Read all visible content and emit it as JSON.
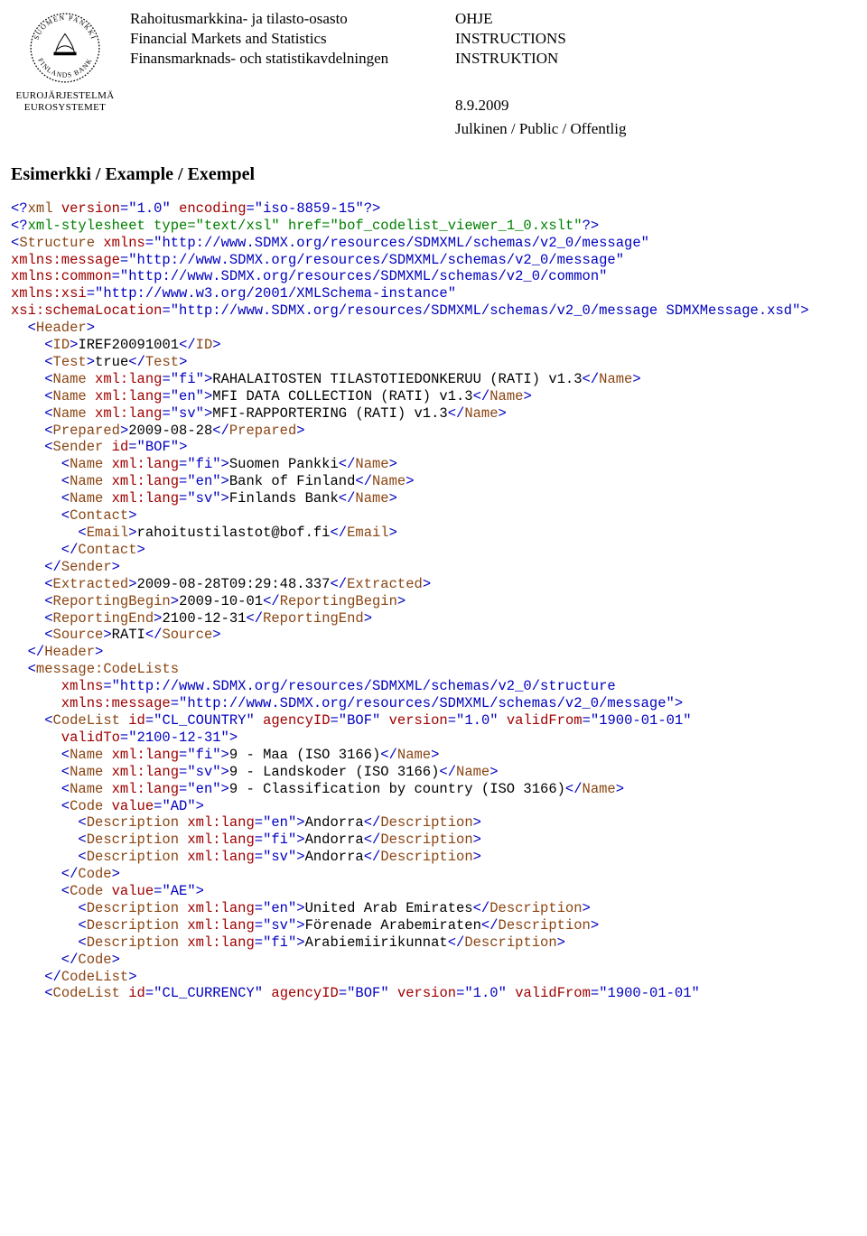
{
  "logo": {
    "top_text": "SUOMEN PANKKI",
    "bottom_text": "FINLANDS BANK",
    "sub1": "EUROJÄRJESTELMÄ",
    "sub2": "EUROSYSTEMET"
  },
  "header": {
    "left": {
      "line1": "Rahoitusmarkkina- ja tilasto-osasto",
      "line2": "Financial Markets and Statistics",
      "line3": "Finansmarknads- och statistikavdelningen"
    },
    "right": {
      "line1": "OHJE",
      "line2": "INSTRUCTIONS",
      "line3": "INSTRUKTION",
      "date": "8.9.2009",
      "visibility": "Julkinen / Public / Offentlig"
    }
  },
  "example_title": "Esimerkki / Example / Exempel",
  "xml": {
    "decl_version": "1.0",
    "decl_encoding": "iso-8859-15",
    "stylesheet_type": "text/xsl",
    "stylesheet_href": "bof_codelist_viewer_1_0.xslt",
    "ns_default": "http://www.SDMX.org/resources/SDMXML/schemas/v2_0/message",
    "ns_message": "http://www.SDMX.org/resources/SDMXML/schemas/v2_0/message",
    "ns_common": "http://www.SDMX.org/resources/SDMXML/schemas/v2_0/common",
    "ns_xsi": "http://www.w3.org/2001/XMLSchema-instance",
    "schema_location": "http://www.SDMX.org/resources/SDMXML/schemas/v2_0/message SDMXMessage.xsd",
    "header": {
      "id": "IREF20091001",
      "test": "true",
      "name_fi": "RAHALAITOSTEN TILASTOTIEDONKERUU (RATI) v1.3",
      "name_en": "MFI DATA COLLECTION (RATI) v1.3",
      "name_sv": "MFI-RAPPORTERING (RATI) v1.3",
      "prepared": "2009-08-28",
      "sender_id": "BOF",
      "sender_name_fi": "Suomen Pankki",
      "sender_name_en": "Bank of Finland",
      "sender_name_sv": "Finlands Bank",
      "email": "rahoitustilastot@bof.fi",
      "extracted": "2009-08-28T09:29:48.337",
      "reporting_begin": "2009-10-01",
      "reporting_end": "2100-12-31",
      "source": "RATI"
    },
    "codelists": {
      "ns_struct": "http://www.SDMX.org/resources/SDMXML/schemas/v2_0/structure",
      "ns_message2": "http://www.SDMX.org/resources/SDMXML/schemas/v2_0/message",
      "cl_country": {
        "id": "CL_COUNTRY",
        "agency": "BOF",
        "version": "1.0",
        "valid_from": "1900-01-01",
        "valid_to": "2100-12-31",
        "name_fi": "9 - Maa (ISO 3166)",
        "name_sv": "9 - Landskoder (ISO 3166)",
        "name_en": "9 - Classification by country (ISO 3166)",
        "code_ad": {
          "value": "AD",
          "desc_en": "Andorra",
          "desc_fi": "Andorra",
          "desc_sv": "Andorra"
        },
        "code_ae": {
          "value": "AE",
          "desc_en": "United Arab Emirates",
          "desc_sv": "Förenade Arabemiraten",
          "desc_fi": "Arabiemiirikunnat"
        }
      },
      "cl_currency": {
        "id": "CL_CURRENCY",
        "agency": "BOF",
        "version": "1.0",
        "valid_from": "1900-01-01"
      }
    }
  }
}
